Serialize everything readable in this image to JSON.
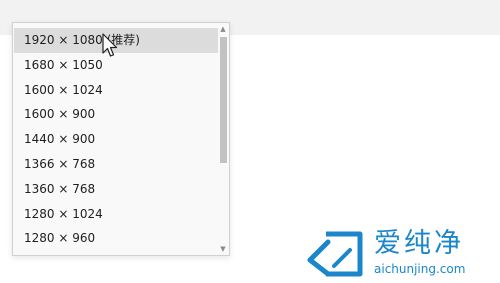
{
  "resolution_dropdown": {
    "selected_index": 0,
    "options": [
      "1920 × 1080 (推荐)",
      "1680 × 1050",
      "1600 × 1024",
      "1600 × 900",
      "1440 × 900",
      "1366 × 768",
      "1360 × 768",
      "1280 × 1024",
      "1280 × 960"
    ]
  },
  "watermark": {
    "name": "爱纯净",
    "url": "aichunjing.com"
  },
  "colors": {
    "list_background": "#f9f9f9",
    "selected_background": "#dcdcdc",
    "scroll_thumb": "#c2c2c2",
    "watermark_blue": "#1b86c9"
  }
}
